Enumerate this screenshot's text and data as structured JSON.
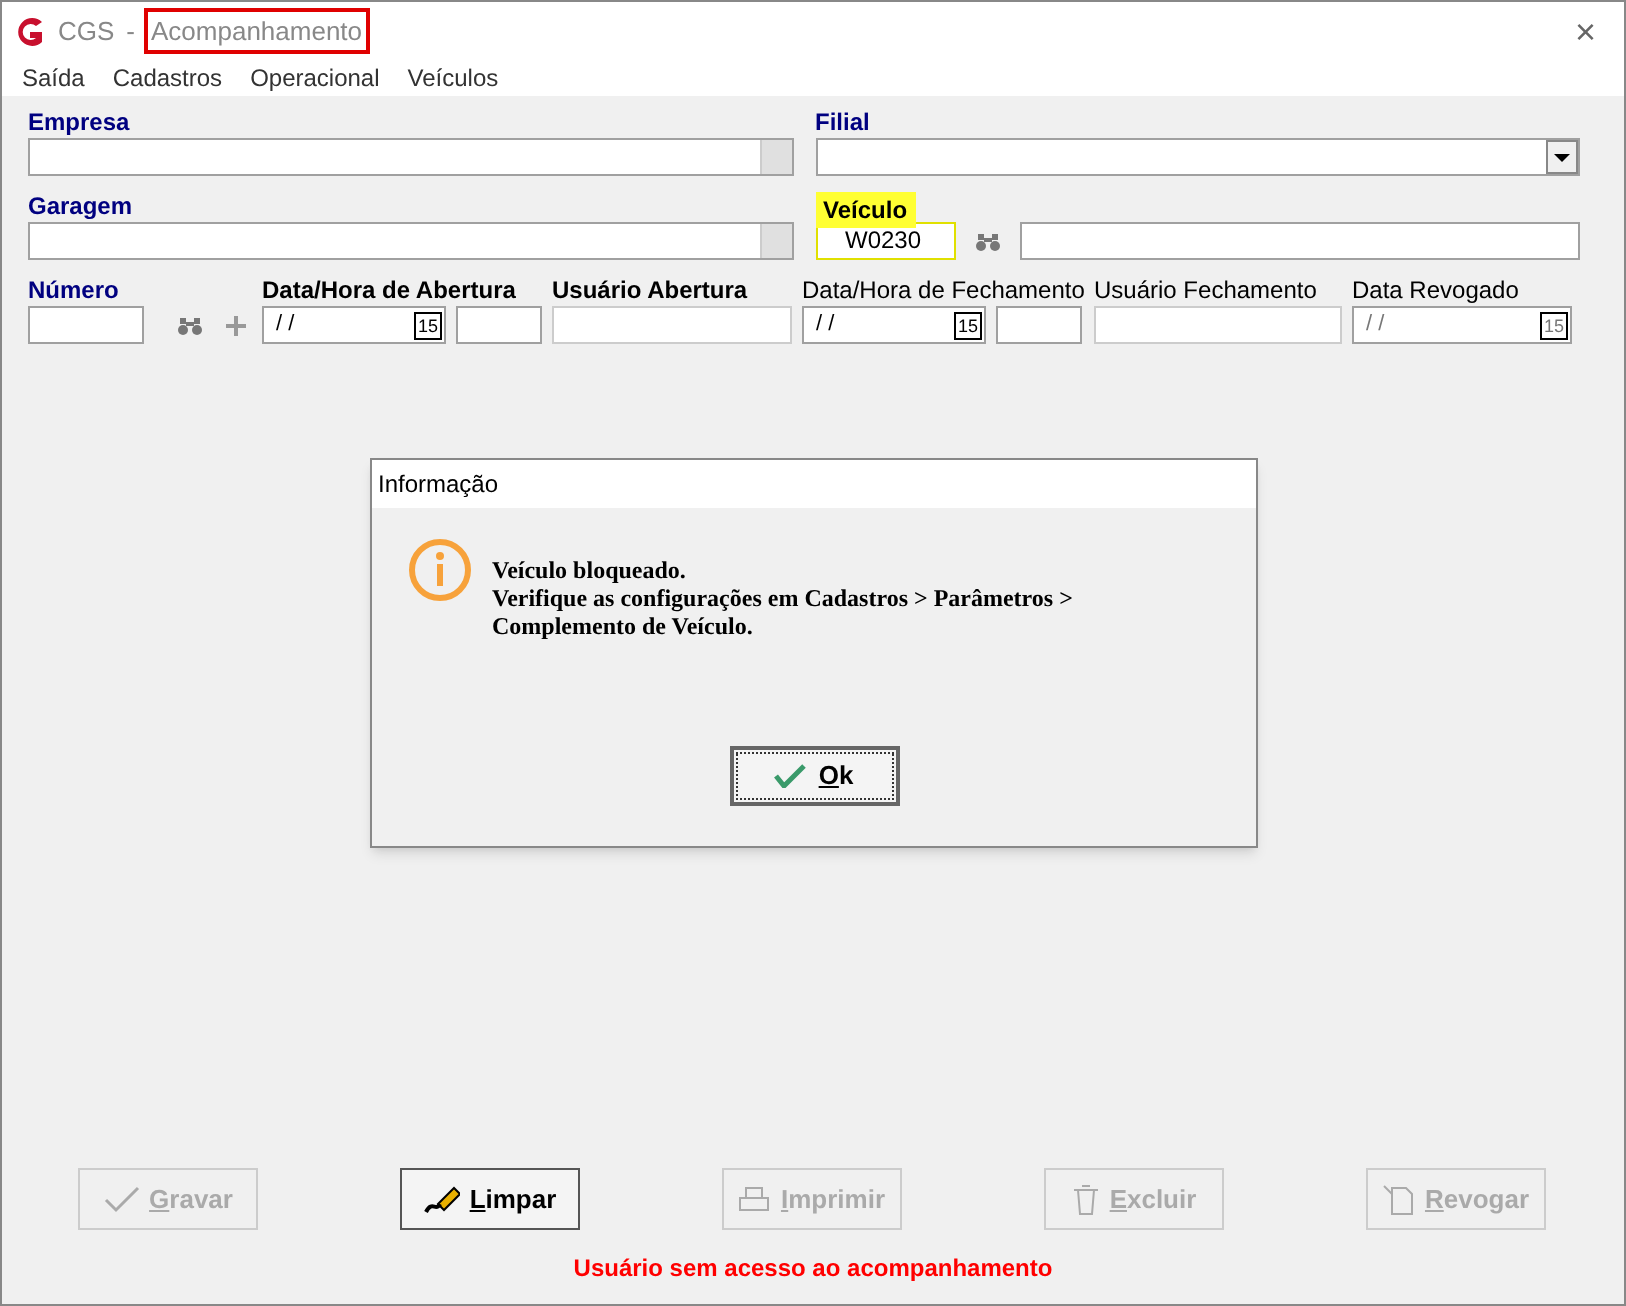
{
  "window": {
    "app": "CGS",
    "separator": "-",
    "title": "Acompanhamento",
    "title_highlighted": true,
    "close": "×"
  },
  "menu": [
    "Saída",
    "Cadastros",
    "Operacional",
    "Veículos"
  ],
  "fields_row1": [
    {
      "label": "Empresa",
      "kind": "lookup"
    },
    {
      "label": "Filial",
      "kind": "dropdown"
    }
  ],
  "fields_row2": [
    {
      "label": "Garagem",
      "kind": "lookup"
    },
    {
      "label": "Veículo",
      "kind": "vehicle",
      "value": "W0230",
      "highlighted": true
    }
  ],
  "fields_row3": [
    {
      "label": "Número",
      "kind": "number"
    },
    {
      "label": "Data/Hora de Abertura",
      "kind": "datetime",
      "date": "/ /",
      "calendar": "15"
    },
    {
      "label": "Usuário Abertura",
      "kind": "readonly"
    },
    {
      "label": "Data/Hora de Fechamento",
      "kind": "datetime",
      "date": "/ /",
      "calendar": "15"
    },
    {
      "label": "Usuário Fechamento",
      "kind": "readonly"
    },
    {
      "label": "Data Revogado",
      "kind": "date",
      "date": "/ /",
      "calendar": "15"
    }
  ],
  "dialog": {
    "title": "Informação",
    "lines": [
      "Veículo bloqueado.",
      "Verifique as configurações em Cadastros > Parâmetros >",
      "Complemento de Veículo."
    ],
    "button": "Ok"
  },
  "buttons": [
    {
      "label": "Gravar",
      "disabled": true
    },
    {
      "label": "Limpar",
      "disabled": false
    },
    {
      "label": "Imprimir",
      "disabled": true
    },
    {
      "label": "Excluir",
      "disabled": true
    },
    {
      "label": "Revogar",
      "disabled": true
    }
  ],
  "status_message": "Usuário sem acesso ao acompanhamento"
}
